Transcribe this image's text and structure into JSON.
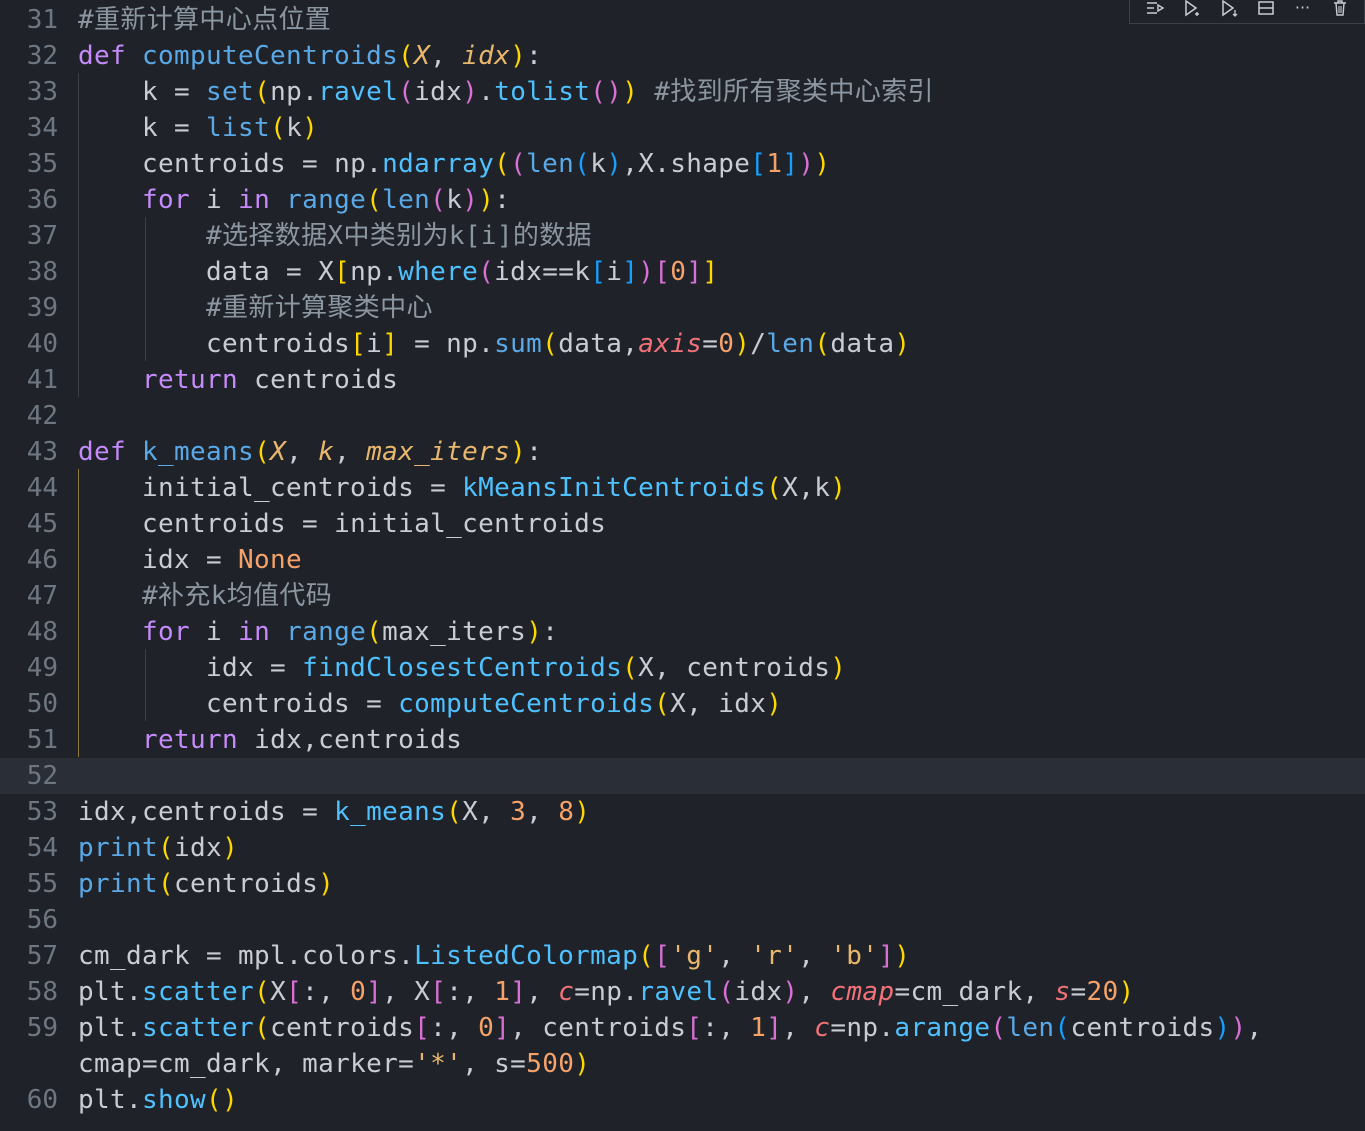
{
  "toolbar": {
    "icons": [
      "run-by-line-icon",
      "execute-above-icon",
      "execute-below-icon",
      "split-cell-icon",
      "more-icon",
      "delete-icon"
    ],
    "more_label": "···"
  },
  "lines": [
    {
      "n": "31",
      "text": "#重新计算中心点位置"
    },
    {
      "n": "32",
      "text": "def computeCentroids(X, idx):"
    },
    {
      "n": "33",
      "text": "    k = set(np.ravel(idx).tolist()) #找到所有聚类中心索引"
    },
    {
      "n": "34",
      "text": "    k = list(k)"
    },
    {
      "n": "35",
      "text": "    centroids = np.ndarray((len(k),X.shape[1]))"
    },
    {
      "n": "36",
      "text": "    for i in range(len(k)):"
    },
    {
      "n": "37",
      "text": "        #选择数据X中类别为k[i]的数据"
    },
    {
      "n": "38",
      "text": "        data = X[np.where(idx==k[i])[0]]"
    },
    {
      "n": "39",
      "text": "        #重新计算聚类中心"
    },
    {
      "n": "40",
      "text": "        centroids[i] = np.sum(data,axis=0)/len(data)"
    },
    {
      "n": "41",
      "text": "    return centroids"
    },
    {
      "n": "42",
      "text": ""
    },
    {
      "n": "43",
      "text": "def k_means(X, k, max_iters):"
    },
    {
      "n": "44",
      "text": "    initial_centroids = kMeansInitCentroids(X,k)"
    },
    {
      "n": "45",
      "text": "    centroids = initial_centroids"
    },
    {
      "n": "46",
      "text": "    idx = None"
    },
    {
      "n": "47",
      "text": "    #补充k均值代码"
    },
    {
      "n": "48",
      "text": "    for i in range(max_iters):"
    },
    {
      "n": "49",
      "text": "        idx = findClosestCentroids(X, centroids)"
    },
    {
      "n": "50",
      "text": "        centroids = computeCentroids(X, idx)"
    },
    {
      "n": "51",
      "text": "    return idx,centroids"
    },
    {
      "n": "52",
      "text": ""
    },
    {
      "n": "53",
      "text": "idx,centroids = k_means(X, 3, 8)"
    },
    {
      "n": "54",
      "text": "print(idx)"
    },
    {
      "n": "55",
      "text": "print(centroids)"
    },
    {
      "n": "56",
      "text": ""
    },
    {
      "n": "57",
      "text": "cm_dark = mpl.colors.ListedColormap(['g', 'r', 'b'])"
    },
    {
      "n": "58",
      "text": "plt.scatter(X[:, 0], X[:, 1], c=np.ravel(idx), cmap=cm_dark, s=20)"
    },
    {
      "n": "59",
      "text": "plt.scatter(centroids[:, 0], centroids[:, 1], c=np.arange(len(centroids)),"
    },
    {
      "n": "",
      "text": "cmap=cm_dark, marker='*', s=500)"
    },
    {
      "n": "60",
      "text": "plt.show()"
    }
  ]
}
